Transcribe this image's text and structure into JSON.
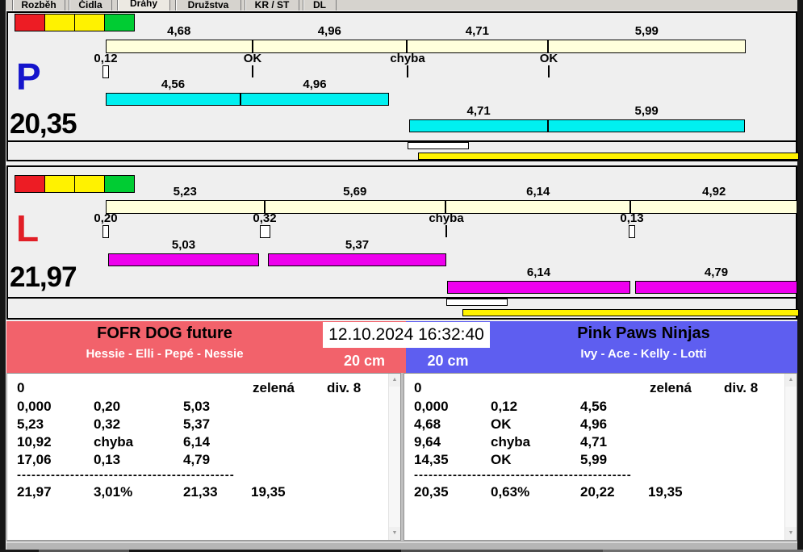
{
  "tabs": {
    "items": [
      "Rozběh",
      "Čidla",
      "Dráhy",
      "Družstva",
      "KR / ST",
      "DL"
    ]
  },
  "lights": {
    "colors": [
      "#ED1C24",
      "#FFF200",
      "#FFF200",
      "#00CC33"
    ]
  },
  "lane_p": {
    "letter": "P",
    "letter_color": "#1414CC",
    "total": "20,35",
    "bar_color": "#00F0F0",
    "segment_times": [
      "4,68",
      "4,96",
      "4,71",
      "5,99"
    ],
    "crossing_markers": [
      "0,12",
      "OK",
      "chyba",
      "OK"
    ],
    "run1_times": [
      "4,56",
      "4,96"
    ],
    "run2_times": [
      "4,71",
      "5,99"
    ]
  },
  "lane_l": {
    "letter": "L",
    "letter_color": "#E11E26",
    "total": "21,97",
    "bar_color": "#EE00EE",
    "segment_times": [
      "5,23",
      "5,69",
      "6,14",
      "4,92"
    ],
    "crossing_markers": [
      "0,20",
      "0,32",
      "chyba",
      "0,13"
    ],
    "run1_times": [
      "5,03",
      "5,37"
    ],
    "run2_times": [
      "6,14",
      "4,79"
    ]
  },
  "scoreboard": {
    "timestamp": "12.10.2024 16:32:40",
    "left_team": {
      "name": "FOFR DOG future",
      "members": "Hessie - Elli - Pepé - Nessie",
      "size_category": "20 cm",
      "color": "#F2626B"
    },
    "right_team": {
      "name": "Pink Paws Ninjas",
      "members": "Ivy - Ace - Kelly - Lotti",
      "size_category": "20 cm",
      "color": "#5E5EF0"
    },
    "left_results": {
      "start": "0",
      "light": "zelená",
      "division": "div. 8",
      "rows": [
        [
          "0,000",
          "0,20",
          "5,03"
        ],
        [
          "5,23",
          "0,32",
          "5,37"
        ],
        [
          "10,92",
          "chyba",
          "6,14"
        ],
        [
          "17,06",
          "0,13",
          "4,79"
        ]
      ],
      "separator": "---------------------------------------------",
      "totals": [
        "21,97",
        "3,01%",
        "21,33",
        "19,35"
      ]
    },
    "right_results": {
      "start": "0",
      "light": "zelená",
      "division": "div. 8",
      "rows": [
        [
          "0,000",
          "0,12",
          "4,56"
        ],
        [
          "4,68",
          "OK",
          "4,96"
        ],
        [
          "9,64",
          "chyba",
          "4,71"
        ],
        [
          "14,35",
          "OK",
          "5,99"
        ]
      ],
      "separator": "---------------------------------------------",
      "totals": [
        "20,35",
        "0,63%",
        "20,22",
        "19,35"
      ]
    }
  }
}
